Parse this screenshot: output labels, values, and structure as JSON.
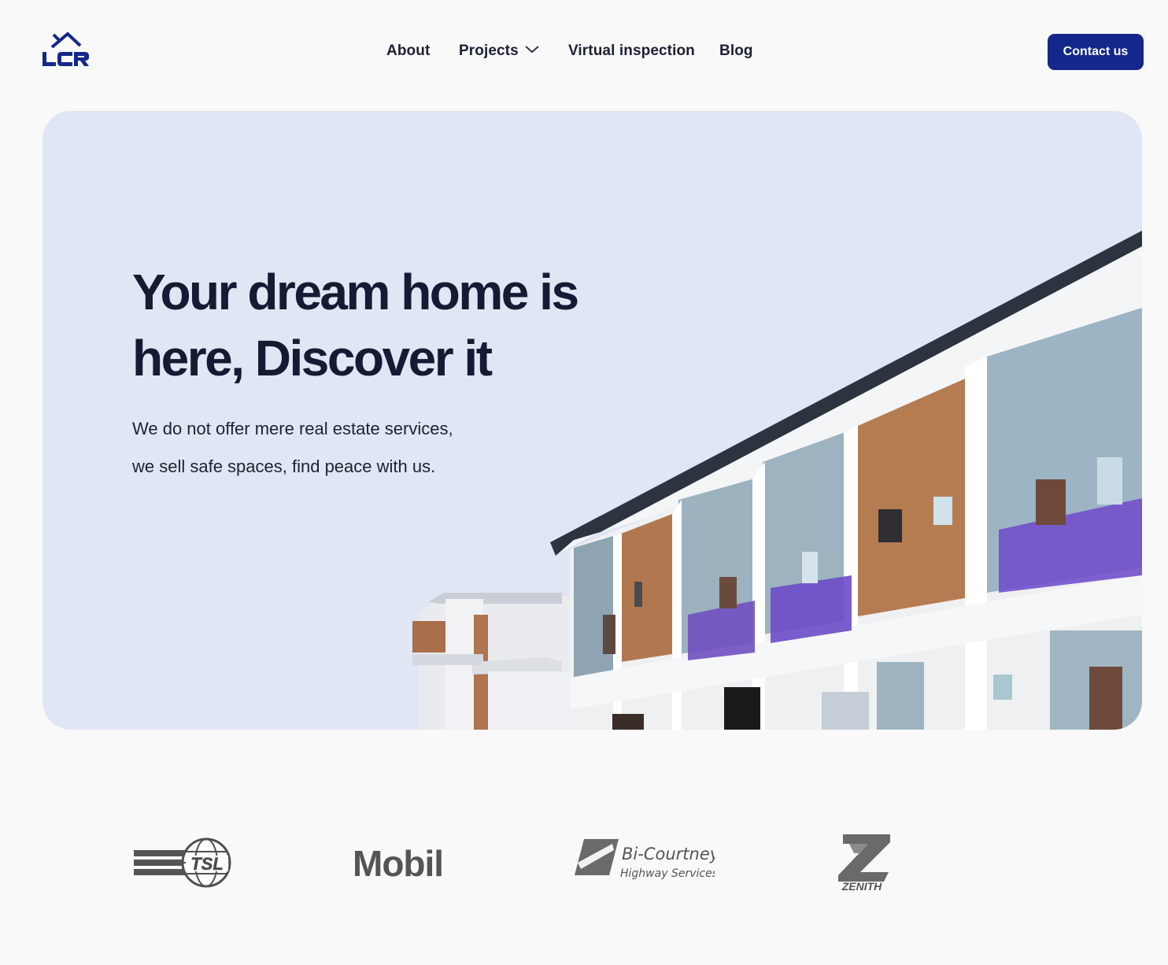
{
  "header": {
    "logo_text": "LCR",
    "nav": {
      "about": "About",
      "projects": "Projects",
      "virtual_inspection": "Virtual inspection",
      "blog": "Blog"
    },
    "contact_label": "Contact us"
  },
  "hero": {
    "title_line1": "Your dream home is",
    "title_line2": "here, Discover it",
    "subtitle_line1": "We do not offer mere real estate services,",
    "subtitle_line2": "we sell safe spaces, find peace with us."
  },
  "partners": {
    "tsl": "TSL",
    "mobil": "Mobil",
    "bicourtney_name": "Bi-Courtney",
    "bicourtney_tagline": "Highway Services Ltd.",
    "zenith": "ZENITH"
  },
  "colors": {
    "brand": "#13288a",
    "hero_bg": "#e0e6f3",
    "page_bg": "#f9f9f9",
    "text_dark": "#141b33"
  },
  "icons": [
    "house-logo-icon",
    "chevron-down-icon"
  ]
}
